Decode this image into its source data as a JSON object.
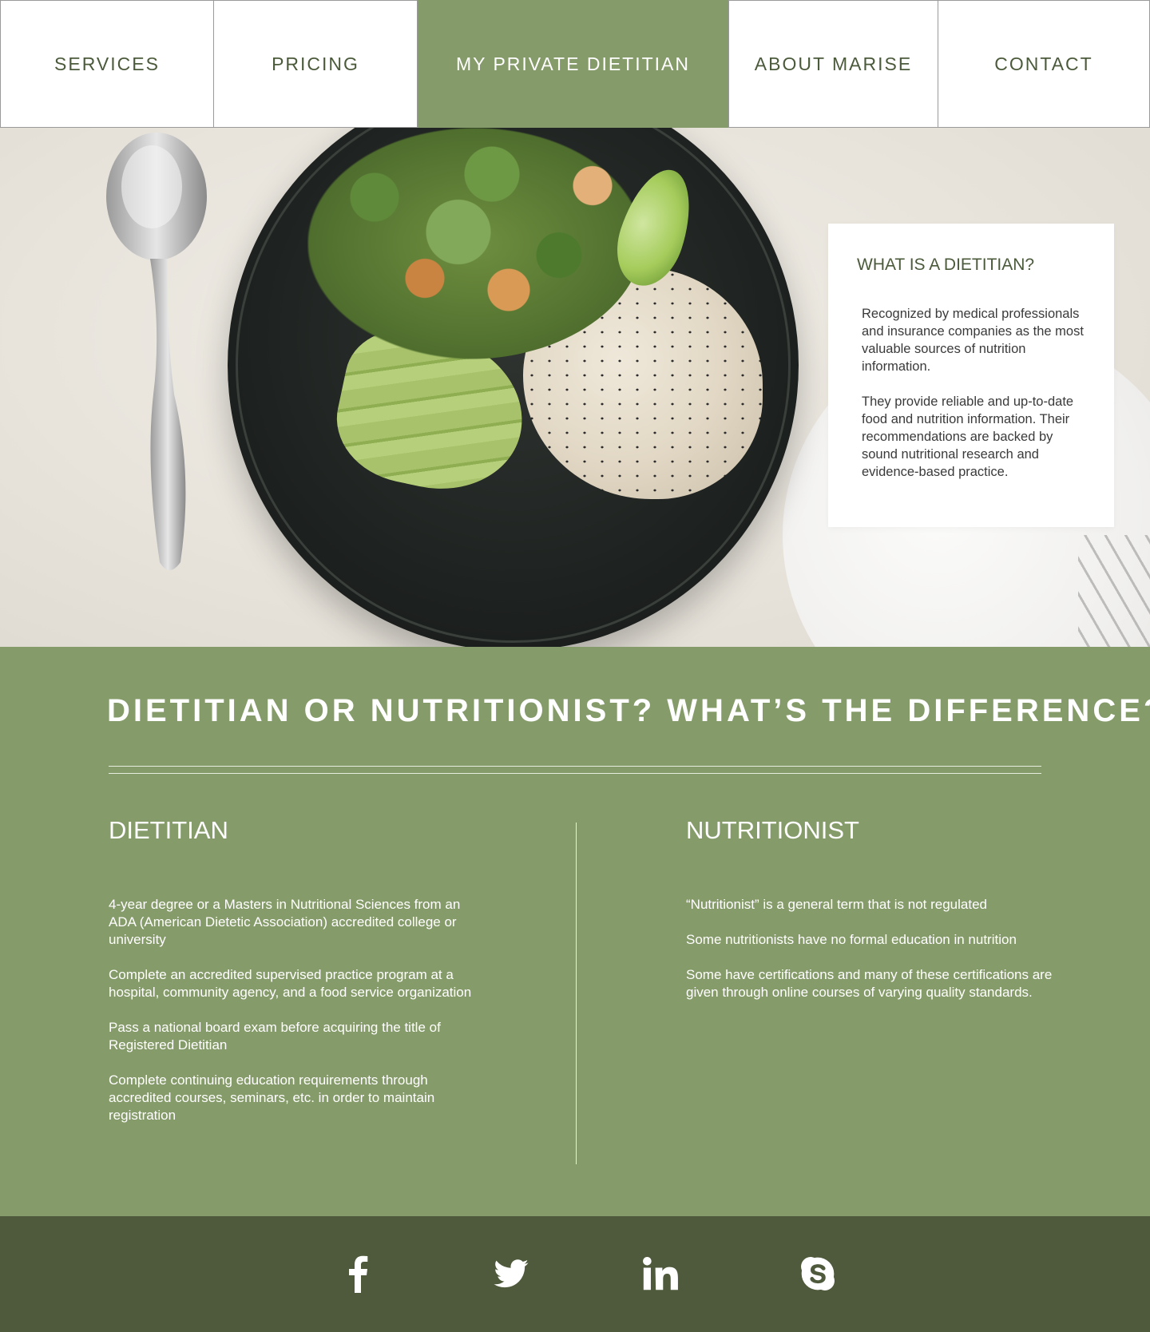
{
  "nav": {
    "items": [
      {
        "label": "SERVICES"
      },
      {
        "label": "PRICING"
      },
      {
        "label": "MY PRIVATE DIETITIAN"
      },
      {
        "label": "ABOUT MARISE"
      },
      {
        "label": "CONTACT"
      }
    ]
  },
  "hero": {
    "card_title": "WHAT IS A DIETITIAN?",
    "card_paragraphs": [
      "Recognized by medical professionals and insurance companies as the most valuable sources of nutrition information.",
      "They provide reliable and up-to-date food and nutrition information. Their recommendations are backed by sound nutritional research and evidence-based practice."
    ]
  },
  "compare": {
    "title": "DIETITIAN OR NUTRITIONIST? WHAT’S THE DIFFERENCE?",
    "dietitian": {
      "heading": "DIETITIAN",
      "points": [
        "4-year degree or a Masters in Nutritional Sciences from an ADA (American Dietetic Association) accredited college or university",
        "Complete an accredited supervised practice program at a hospital, community agency, and a food service organization",
        "Pass a national board exam before acquiring the title of Registered Dietitian",
        "Complete continuing education requirements through accredited courses, seminars, etc. in order to maintain registration"
      ]
    },
    "nutritionist": {
      "heading": "NUTRITIONIST",
      "points": [
        "“Nutritionist” is a general term that is not regulated",
        "Some nutritionists have no formal education in nutrition",
        "Some have certifications and many of these certifications are given through online courses of varying quality standards."
      ]
    }
  },
  "footer": {
    "social": [
      {
        "icon": "facebook-icon"
      },
      {
        "icon": "twitter-icon"
      },
      {
        "icon": "linkedin-icon"
      },
      {
        "icon": "skype-icon"
      }
    ]
  },
  "colors": {
    "accent": "#859b69",
    "footer": "#4e5a3b",
    "nav_text": "#4b5a3a"
  }
}
